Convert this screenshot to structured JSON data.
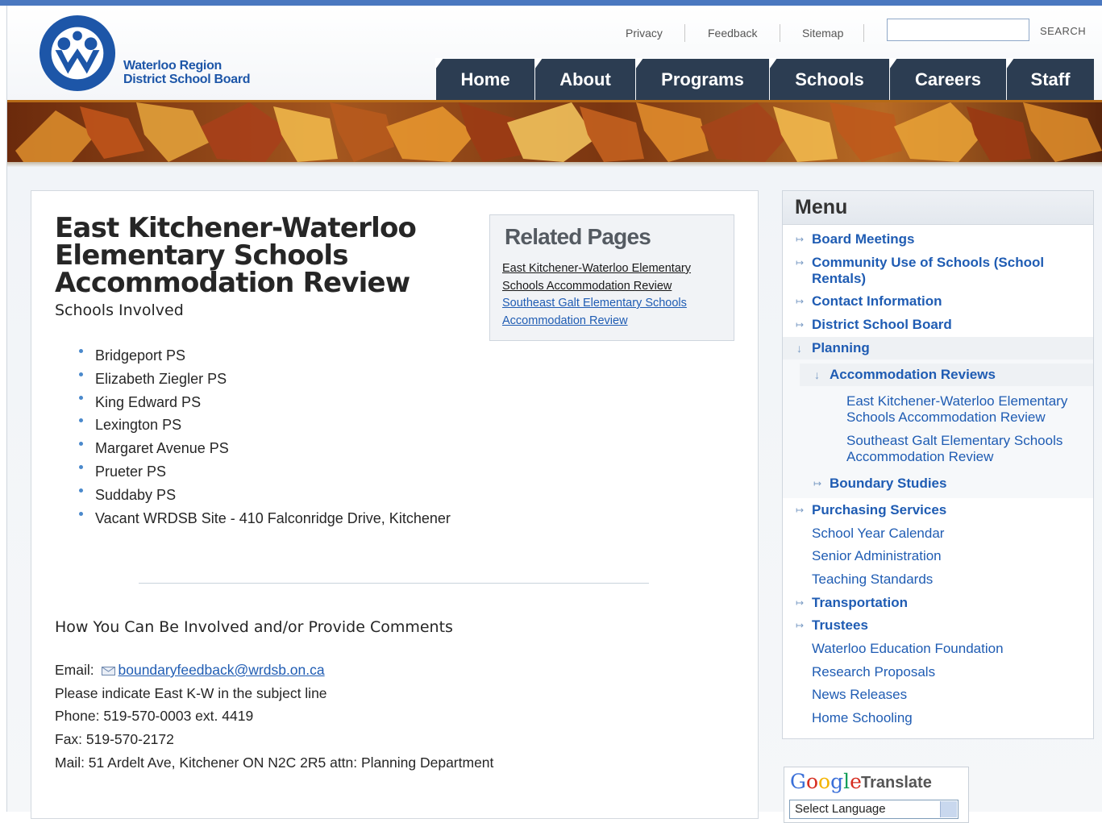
{
  "header": {
    "logo_line1": "Waterloo Region",
    "logo_line2": "District School Board",
    "logo_ring_text": "WATERLOO REGION DISTRICT SCHOOL BOARD",
    "utility_links": [
      "Privacy",
      "Feedback",
      "Sitemap"
    ],
    "search_label": "SEARCH",
    "search_value": ""
  },
  "nav": {
    "tabs": [
      "Home",
      "About",
      "Programs",
      "Schools",
      "Careers",
      "Staff"
    ]
  },
  "main": {
    "title": "East Kitchener-Waterloo Elementary Schools Accommodation Review",
    "subtitle": "Schools Involved",
    "schools": [
      "Bridgeport PS",
      "Elizabeth Ziegler PS",
      "King Edward PS",
      "Lexington PS",
      "Margaret Avenue PS",
      "Prueter PS",
      "Suddaby PS",
      "Vacant WRDSB Site - 410 Falconridge Drive, Kitchener"
    ],
    "involved_heading": "How You Can Be Involved and/or Provide Comments",
    "email_label": "Email:",
    "email_address": "boundaryfeedback@wrdsb.on.ca",
    "subject_note": "Please indicate East K-W in the subject line",
    "phone": "Phone: 519-570-0003 ext. 4419",
    "fax": "Fax: 519-570-2172",
    "mail": "Mail: 51 Ardelt Ave, Kitchener ON N2C 2R5 attn: Planning Department"
  },
  "related": {
    "title": "Related Pages",
    "link1_line1": "East Kitchener-Waterloo Elementary",
    "link1_line2": "Schools Accommodation Review",
    "link2_line1": "Southeast Galt Elementary Schools",
    "link2_line2": "Accommodation Review"
  },
  "menu": {
    "title": "Menu",
    "board_meetings": "Board Meetings",
    "community_use_1": "Community Use of Schools (School",
    "community_use_2": "Rentals)",
    "contact_info": "Contact Information",
    "district_board": "District School Board",
    "planning": "Planning",
    "accommodation_reviews": "Accommodation Reviews",
    "ekw_1": "East Kitchener-Waterloo Elementary",
    "ekw_2": "Schools Accommodation Review",
    "sgalt_1": "Southeast Galt Elementary Schools",
    "sgalt_2": "Accommodation Review",
    "boundary_studies": "Boundary Studies",
    "purchasing": "Purchasing Services",
    "calendar": "School Year Calendar",
    "senior_admin": "Senior Administration",
    "teaching_standards": "Teaching Standards",
    "transportation": "Transportation",
    "trustees": "Trustees",
    "foundation": "Waterloo Education Foundation",
    "research": "Research Proposals",
    "news": "News Releases",
    "home_schooling": "Home Schooling"
  },
  "translate": {
    "google_word": "Google",
    "translate_word": "Translate",
    "select_value": "Select Language"
  },
  "colors": {
    "nav_bg": "#2c3d52",
    "link_blue": "#1f5cb3",
    "accent_gold": "#b66a17"
  }
}
